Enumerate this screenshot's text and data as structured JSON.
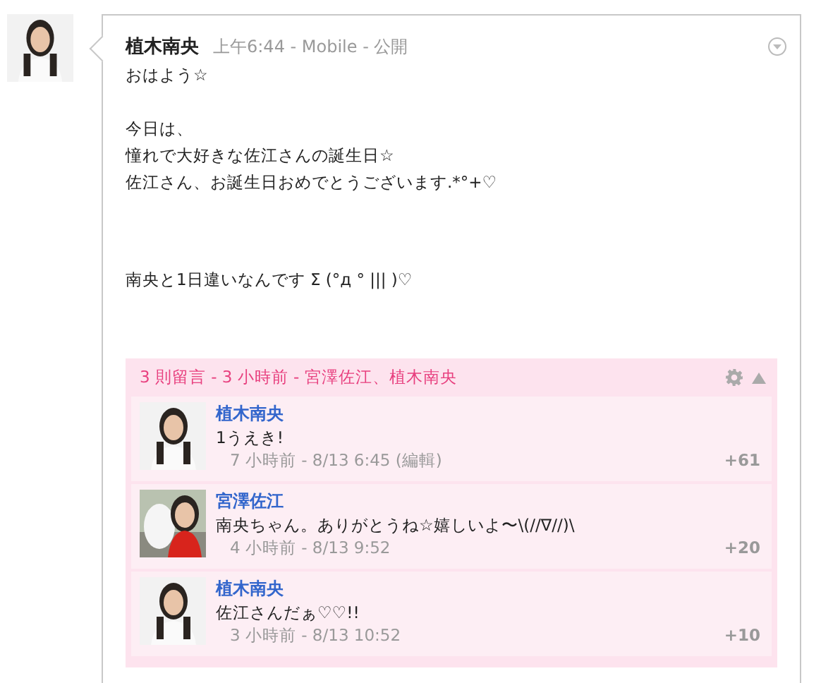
{
  "post": {
    "author": "植木南央",
    "meta": "上午6:44 - Mobile - 公開",
    "paragraphs": [
      [
        "おはよう☆"
      ],
      [
        "今日は、",
        "憧れで大好きな佐江さんの誕生日☆",
        "佐江さん、お誕生日おめでとうございます.*°+♡"
      ],
      [
        "南央と1日違いなんです Σ (°д ° ||| )♡"
      ]
    ]
  },
  "comments": {
    "summary": "3 則留言 - 3 小時前 - 宮澤佐江、植木南央",
    "items": [
      {
        "author": "植木南央",
        "text": "1うえき!",
        "meta": "7 小時前 - 8/13 6:45 (編輯)",
        "plus": "+61"
      },
      {
        "author": "宮澤佐江",
        "text": "南央ちゃん。ありがとうね☆嬉しいよ〜\\(//∇//)\\",
        "meta": "4 小時前 - 8/13 9:52",
        "plus": "+20"
      },
      {
        "author": "植木南央",
        "text": "佐江さんだぁ♡♡!!",
        "meta": "3 小時前 - 8/13 10:52",
        "plus": "+10"
      }
    ]
  }
}
